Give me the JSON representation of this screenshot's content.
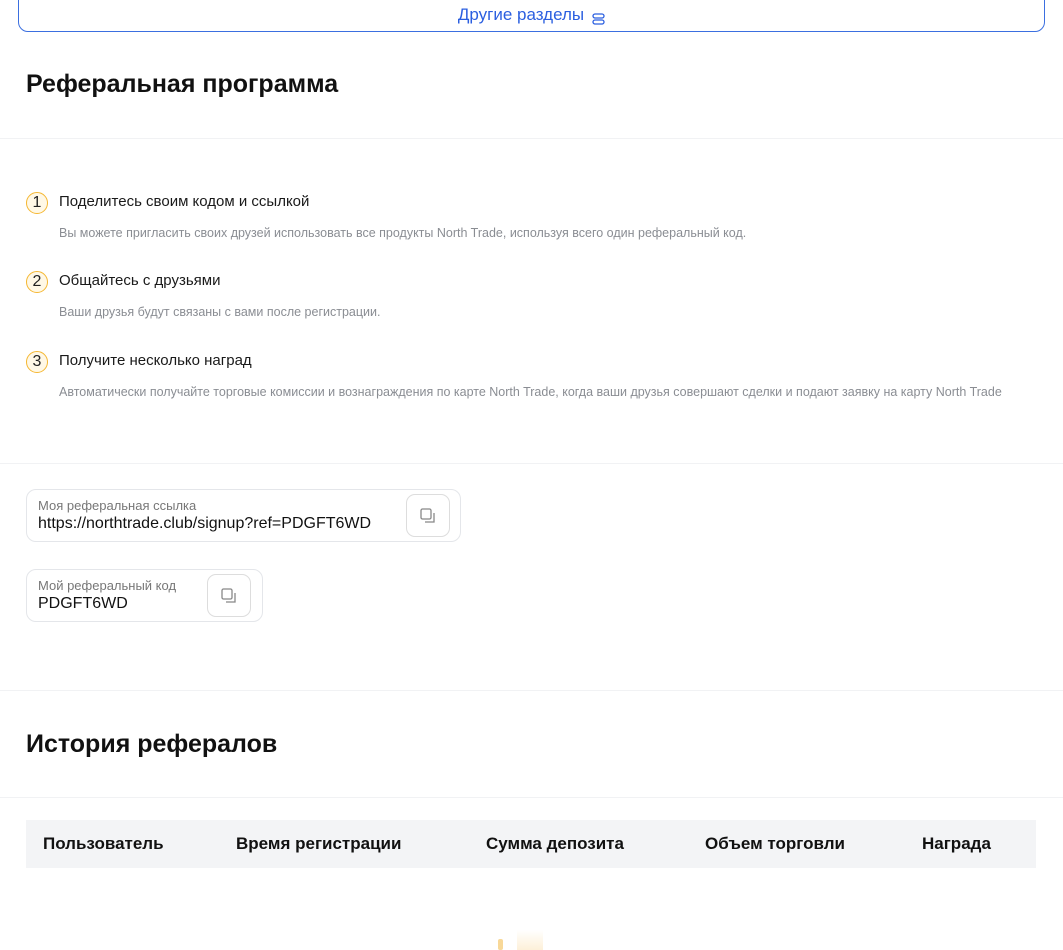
{
  "top_button": {
    "label": "Другие разделы",
    "icon": "list-icon"
  },
  "page_title": "Реферальная программа",
  "steps": [
    {
      "num": "1",
      "title": "Поделитесь своим кодом и ссылкой",
      "desc": "Вы можете пригласить своих друзей использовать все продукты North Trade, используя всего один реферальный код."
    },
    {
      "num": "2",
      "title": "Общайтесь с друзьями",
      "desc": "Ваши друзья будут связаны с вами после регистрации."
    },
    {
      "num": "3",
      "title": "Получите несколько наград",
      "desc": "Автоматически получайте торговые комиссии и вознаграждения по карте North Trade, когда ваши друзья совершают сделки и подают заявку на карту North Trade"
    }
  ],
  "ref_link": {
    "label": "Моя реферальная ссылка",
    "value": "https://northtrade.club/signup?ref=PDGFT6WD"
  },
  "ref_code": {
    "label": "Мой реферальный код",
    "value": "PDGFT6WD"
  },
  "history_title": "История рефералов",
  "table": {
    "columns": [
      "Пользователь",
      "Время регистрации",
      "Сумма депозита",
      "Объем торговли",
      "Награда"
    ]
  },
  "colors": {
    "accent": "#2b5fe0",
    "step": "#f5b731"
  }
}
